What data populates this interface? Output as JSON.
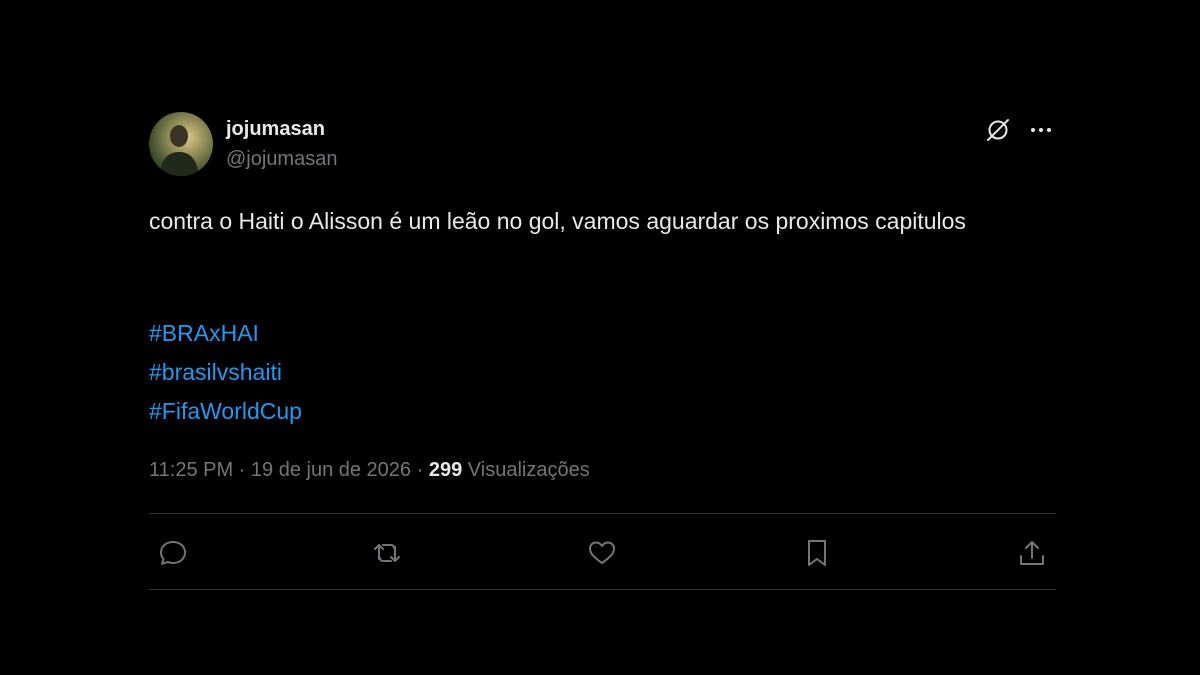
{
  "tweet": {
    "display_name": "jojumasan",
    "handle": "@jojumasan",
    "text": "contra o Haiti o Alisson é um leão no gol, vamos aguardar os proximos capitulos",
    "hashtags": [
      "#BRAxHAI",
      "#brasilvshaiti",
      "#FifaWorldCup"
    ],
    "time": "11:25 PM",
    "separator": " · ",
    "date": "19 de jun de 2026",
    "views_count": "299",
    "views_label": " Visualizações"
  },
  "icons": {
    "header": [
      "grok-icon",
      "more-icon"
    ],
    "actions": [
      "reply-icon",
      "retweet-icon",
      "like-icon",
      "bookmark-icon",
      "share-icon"
    ]
  },
  "colors": {
    "background": "#000000",
    "text": "#e7e9ea",
    "secondary": "#71767b",
    "link": "#1d9bf0",
    "divider": "#2f3336"
  }
}
